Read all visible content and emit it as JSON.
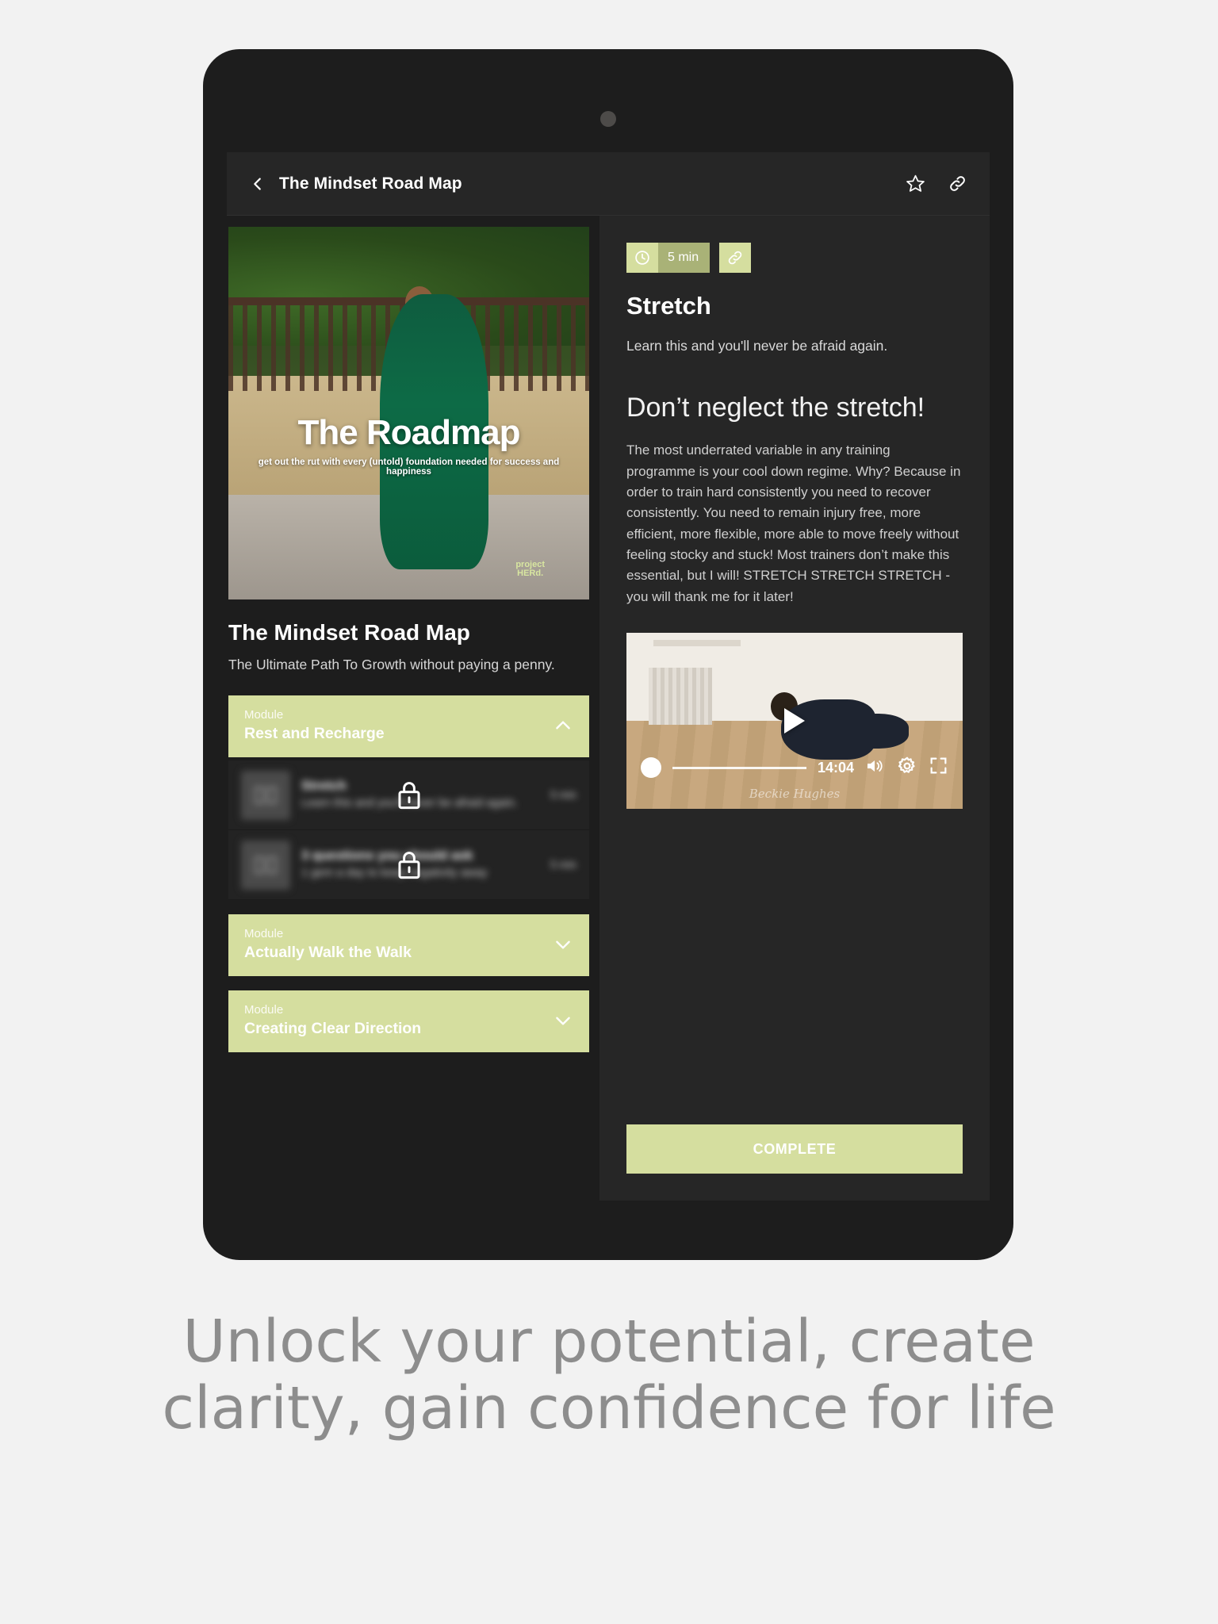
{
  "device": {
    "frame_color": "#1d1d1d",
    "screen_bg": "#262626"
  },
  "accent": {
    "sage": "#d5de9f",
    "sage_dark": "#a9b277"
  },
  "topbar": {
    "back_icon": "chevron-left-icon",
    "title": "The Mindset Road Map",
    "actions": [
      {
        "icon": "star-icon",
        "name": "favorite-button"
      },
      {
        "icon": "link-icon",
        "name": "share-link-button"
      }
    ]
  },
  "course": {
    "cover": {
      "title": "The Roadmap",
      "subtitle": "get out the rut with every (untold) foundation needed for success and happiness",
      "logo_line1": "project",
      "logo_line2": "HERd."
    },
    "title": "The Mindset Road Map",
    "subtitle": "The Ultimate Path To  Growth without paying a penny.",
    "modules": [
      {
        "kicker": "Module",
        "name": "Rest and Recharge",
        "chevron": "chevron-up-icon",
        "expanded": true,
        "lessons": [
          {
            "title": "Stretch",
            "description": "Learn this and you'll never be afraid again.",
            "duration": "5 min",
            "thumb_icon": "book-icon",
            "locked": true,
            "lock_icon": "lock-icon"
          },
          {
            "title": "3 questions you should ask",
            "description": "1 gem a day to keep negativity away",
            "duration": "5 min",
            "thumb_icon": "book-icon",
            "locked": true,
            "lock_icon": "lock-icon"
          }
        ]
      },
      {
        "kicker": "Module",
        "name": "Actually Walk the Walk",
        "chevron": "chevron-down-icon",
        "expanded": false,
        "lessons": []
      },
      {
        "kicker": "Module",
        "name": "Creating Clear Direction",
        "chevron": "chevron-down-icon",
        "expanded": false,
        "lessons": []
      }
    ]
  },
  "lesson": {
    "badges": {
      "clock_icon": "clock-icon",
      "duration": "5 min",
      "link_icon": "link-icon"
    },
    "title": "Stretch",
    "subtitle": "Learn this and you'll never be afraid again.",
    "heading": "Don’t neglect the stretch!",
    "body": "The most underrated variable in any training programme is your cool down regime. Why? Because in order to train hard consistently you need to recover consistently. You need to remain injury free, more efficient, more flexible, more able to move freely without feeling stocky and stuck! Most trainers don’t make this essential, but I will! STRETCH STRETCH STRETCH - you will thank me for it later!",
    "video": {
      "play_icon": "play-icon",
      "time": "14:04",
      "volume_icon": "volume-icon",
      "settings_icon": "gear-icon",
      "fullscreen_icon": "fullscreen-icon",
      "watermark": "Beckie Hughes",
      "progress_percent": 0
    },
    "complete_label": "COMPLETE"
  },
  "caption": "Unlock your potential, create clarity, gain confidence for life"
}
